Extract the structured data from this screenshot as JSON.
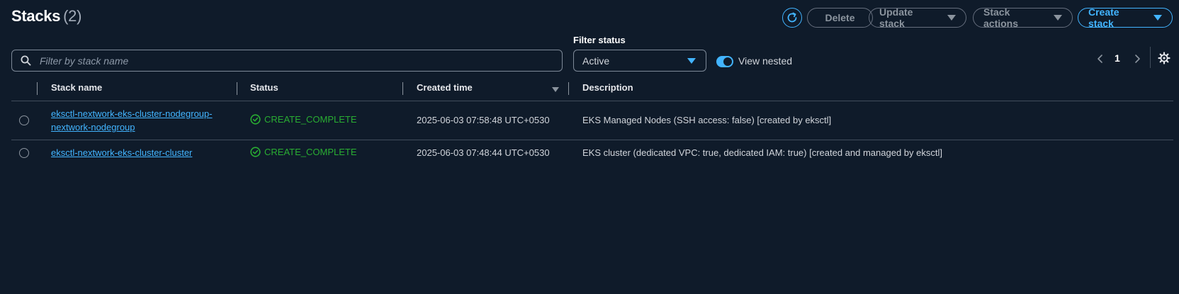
{
  "header": {
    "title": "Stacks",
    "count": "(2)"
  },
  "toolbar": {
    "refresh_icon": "refresh-icon",
    "delete_label": "Delete",
    "update_label": "Update stack",
    "actions_label": "Stack actions",
    "create_label": "Create stack"
  },
  "filters": {
    "search_placeholder": "Filter by stack name",
    "search_value": "",
    "status_label": "Filter status",
    "status_value": "Active",
    "view_nested_label": "View nested",
    "view_nested_on": true
  },
  "pagination": {
    "current_page": "1"
  },
  "table": {
    "columns": [
      "Stack name",
      "Status",
      "Created time",
      "Description"
    ],
    "sort_column": "Created time",
    "rows": [
      {
        "name": "eksctl-nextwork-eks-cluster-nodegroup-nextwork-nodegroup",
        "status": "CREATE_COMPLETE",
        "created": "2025-06-03 07:58:48 UTC+0530",
        "description": "EKS Managed Nodes (SSH access: false) [created by eksctl]"
      },
      {
        "name": "eksctl-nextwork-eks-cluster-cluster",
        "status": "CREATE_COMPLETE",
        "created": "2025-06-03 07:48:44 UTC+0530",
        "description": "EKS cluster (dedicated VPC: true, dedicated IAM: true) [created and managed by eksctl]"
      }
    ]
  },
  "colors": {
    "background": "#0f1b2a",
    "accent": "#42b4ff",
    "success": "#29ad32"
  }
}
